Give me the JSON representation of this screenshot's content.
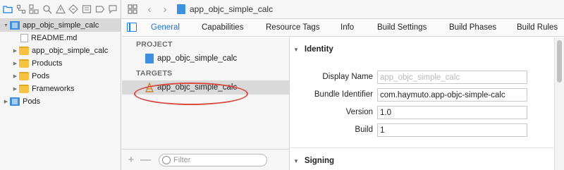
{
  "navigator": {
    "toolbar_icons": [
      "folder-icon",
      "source-control-icon",
      "hierarchy-icon",
      "search-icon",
      "warning-icon",
      "test-icon",
      "debug-icon",
      "breakpoint-icon",
      "report-icon"
    ],
    "items": [
      {
        "label": "app_objc_simple_calc",
        "kind": "project",
        "expanded": true,
        "selected": true
      },
      {
        "label": "README.md",
        "kind": "file"
      },
      {
        "label": "app_objc_simple_calc",
        "kind": "folder"
      },
      {
        "label": "Products",
        "kind": "folder"
      },
      {
        "label": "Pods",
        "kind": "folder"
      },
      {
        "label": "Frameworks",
        "kind": "folder"
      },
      {
        "label": "Pods",
        "kind": "project"
      }
    ]
  },
  "jump_bar": {
    "breadcrumb": "app_objc_simple_calc"
  },
  "tabs": [
    "General",
    "Capabilities",
    "Resource Tags",
    "Info",
    "Build Settings",
    "Build Phases",
    "Build Rules"
  ],
  "active_tab": "General",
  "targets_pane": {
    "project_header": "PROJECT",
    "project_item": "app_objc_simple_calc",
    "targets_header": "TARGETS",
    "target_item": "app_objc_simple_calc",
    "filter_placeholder": "Filter",
    "add_label": "+",
    "remove_label": "—"
  },
  "identity": {
    "section_title": "Identity",
    "display_name_label": "Display Name",
    "display_name_placeholder": "app_objc_simple_calc",
    "bundle_id_label": "Bundle Identifier",
    "bundle_id_value": "com.haymuto.app-objc-simple-calc",
    "version_label": "Version",
    "version_value": "1.0",
    "build_label": "Build",
    "build_value": "1"
  },
  "signing": {
    "section_title": "Signing"
  },
  "colors": {
    "accent": "#1a6fd6",
    "highlight_ellipse": "#d64a42",
    "folder": "#f5c242",
    "project": "#3d8fe0"
  }
}
